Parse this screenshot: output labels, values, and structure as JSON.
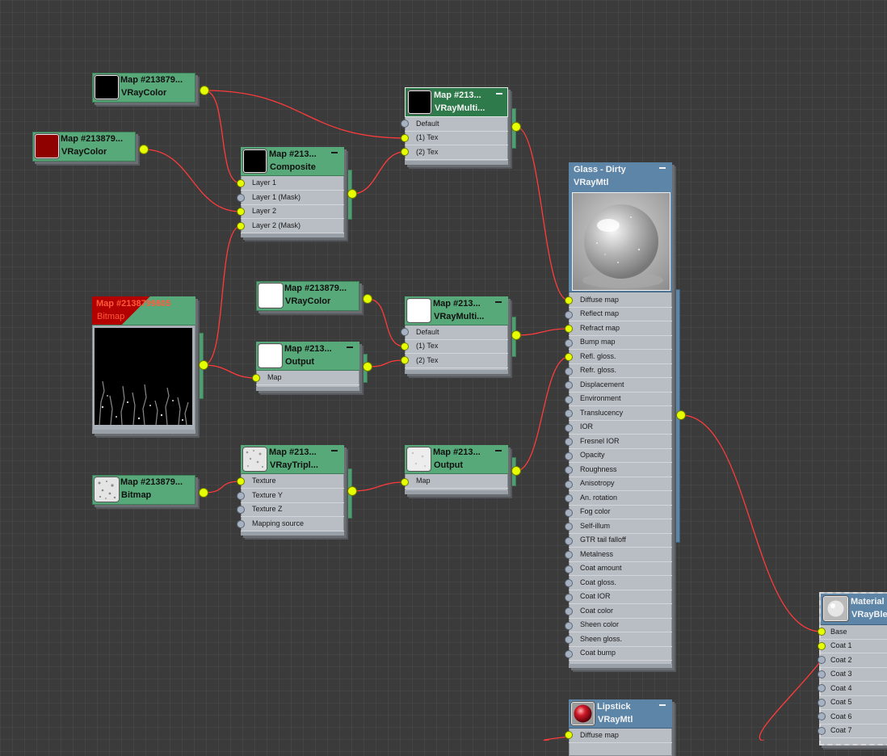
{
  "nodes": {
    "vraycolor_black": {
      "name": "Map #213879...",
      "type": "VRayColor"
    },
    "vraycolor_red": {
      "name": "Map #213879...",
      "type": "VRayColor"
    },
    "composite": {
      "name": "Map #213...",
      "type": "Composite",
      "slots": [
        "Layer 1",
        "Layer 1 (Mask)",
        "Layer 2",
        "Layer 2 (Mask)"
      ]
    },
    "vraymulti_top": {
      "name": "Map #213...",
      "type": "VRayMulti...",
      "slots": [
        "Default",
        "(1) Tex",
        "(2) Tex"
      ]
    },
    "bitmap_large": {
      "name": "Map #2138799805",
      "type": "Bitmap"
    },
    "vraycolor_white": {
      "name": "Map #213879...",
      "type": "VRayColor"
    },
    "output_mid": {
      "name": "Map #213...",
      "type": "Output",
      "slots": [
        "Map"
      ]
    },
    "vraymulti_mid": {
      "name": "Map #213...",
      "type": "VRayMulti...",
      "slots": [
        "Default",
        "(1) Tex",
        "(2) Tex"
      ]
    },
    "bitmap_small": {
      "name": "Map #213879...",
      "type": "Bitmap"
    },
    "vraytriplanar": {
      "name": "Map #213...",
      "type": "VRayTripl...",
      "slots": [
        "Texture",
        "Texture Y",
        "Texture Z",
        "Mapping source"
      ]
    },
    "output_low": {
      "name": "Map #213...",
      "type": "Output",
      "slots": [
        "Map"
      ]
    },
    "glass": {
      "name": "Glass - Dirty",
      "type": "VRayMtl",
      "slots": [
        "Diffuse map",
        "Reflect map",
        "Refract map",
        "Bump map",
        "Refl. gloss.",
        "Refr. gloss.",
        "Displacement",
        "Environment",
        "Translucency",
        "IOR",
        "Fresnel IOR",
        "Opacity",
        "Roughness",
        "Anisotropy",
        "An. rotation",
        "Fog color",
        "Self-illum",
        "GTR tail falloff",
        "Metalness",
        "Coat amount",
        "Coat gloss.",
        "Coat IOR",
        "Coat color",
        "Sheen color",
        "Sheen gloss.",
        "Coat bump"
      ]
    },
    "blend": {
      "name": "Material",
      "type": "VRayBle",
      "slots": [
        "Base",
        "Coat 1",
        "Coat 2",
        "Coat 3",
        "Coat 4",
        "Coat 5",
        "Coat 6",
        "Coat 7"
      ]
    },
    "lipstick": {
      "name": "Lipstick",
      "type": "VRayMtl",
      "slots": [
        "Diffuse map"
      ]
    }
  },
  "colors": {
    "wire": "#ff3b3b",
    "pin_connected": "#e6ff00",
    "pin_empty": "#a6b1c2",
    "map_header": "#58a97a",
    "material_header": "#5d85a8",
    "bitmap_error_header": "#b30000"
  }
}
